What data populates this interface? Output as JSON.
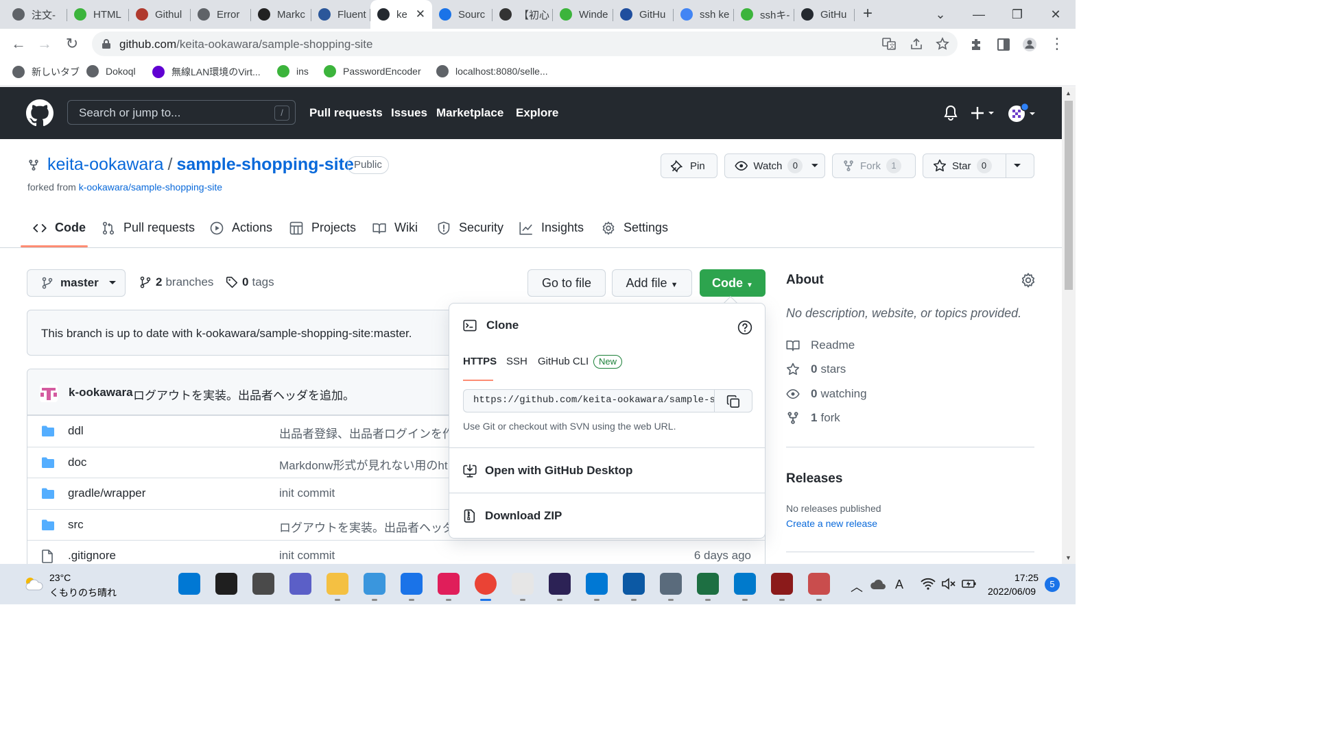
{
  "browser": {
    "tabs": [
      {
        "label": "注文-",
        "color": "#5f6368"
      },
      {
        "label": "HTML",
        "color": "#3cb43c"
      },
      {
        "label": "Githul",
        "color": "#b03a2e"
      },
      {
        "label": "Error",
        "color": "#5f6368"
      },
      {
        "label": "Markc",
        "color": "#222222"
      },
      {
        "label": "Fluent",
        "color": "#2b579a"
      },
      {
        "label": "ke",
        "color": "#24292f",
        "active": true
      },
      {
        "label": "Sourc",
        "color": "#1a73e8"
      },
      {
        "label": "【初心",
        "color": "#333333"
      },
      {
        "label": "Winde",
        "color": "#3cb43c"
      },
      {
        "label": "GitHu",
        "color": "#1f4e9e"
      },
      {
        "label": "ssh ke",
        "color": "#4285f4"
      },
      {
        "label": "sshキ-",
        "color": "#3cb43c"
      },
      {
        "label": "GitHu",
        "color": "#24292f"
      }
    ],
    "url_host": "github.com",
    "url_path": "/keita-ookawara/sample-shopping-site",
    "bookmarks": [
      {
        "label": "新しいタブ",
        "color": "#5f6368"
      },
      {
        "label": "Dokoql",
        "color": "#5f6368"
      },
      {
        "label": "無線LAN環境のVirt...",
        "color": "#6001d2"
      },
      {
        "label": "ins",
        "color": "#3cb43c"
      },
      {
        "label": "PasswordEncoder",
        "color": "#3cb43c"
      },
      {
        "label": "localhost:8080/selle...",
        "color": "#5f6368"
      }
    ]
  },
  "github": {
    "search_placeholder": "Search or jump to...",
    "search_key": "/",
    "nav": [
      "Pull requests",
      "Issues",
      "Marketplace",
      "Explore"
    ]
  },
  "repo": {
    "owner": "keita-ookawara",
    "name": "sample-shopping-site",
    "visibility": "Public",
    "forked_prefix": "forked from",
    "forked_source": "k-ookawara/sample-shopping-site",
    "pin_label": "Pin",
    "watch_label": "Watch",
    "watch_count": "0",
    "fork_label": "Fork",
    "fork_count": "1",
    "star_label": "Star",
    "star_count": "0",
    "tabs": [
      "Code",
      "Pull requests",
      "Actions",
      "Projects",
      "Wiki",
      "Security",
      "Insights",
      "Settings"
    ],
    "branch": "master",
    "branches_count": "2",
    "branches_label": "branches",
    "tags_count": "0",
    "tags_label": "tags",
    "go_to_file": "Go to file",
    "add_file": "Add file",
    "code_btn": "Code",
    "up_to_date": "This branch is up to date with k-ookawara/sample-shopping-site:master.",
    "commit_author": "k-ookawara",
    "commit_message": "ログアウトを実装。出品者ヘッダを追加。",
    "files": [
      {
        "name": "ddl",
        "type": "dir",
        "message": "出品者登録、出品者ログインを作",
        "age": ""
      },
      {
        "name": "doc",
        "type": "dir",
        "message": "Markdonw形式が見れない用のht",
        "age": ""
      },
      {
        "name": "gradle/wrapper",
        "type": "dir",
        "message": "init commit",
        "age": ""
      },
      {
        "name": "src",
        "type": "dir",
        "message": "ログアウトを実装。出品者ヘッダ",
        "age": ""
      },
      {
        "name": ".gitignore",
        "type": "file",
        "message": "init commit",
        "age": "6 days ago"
      }
    ]
  },
  "clone": {
    "title": "Clone",
    "tabs": [
      "HTTPS",
      "SSH",
      "GitHub CLI"
    ],
    "new_badge": "New",
    "url": "https://github.com/keita-ookawara/sample-shopping-site.git",
    "hint": "Use Git or checkout with SVN using the web URL.",
    "open_desktop": "Open with GitHub Desktop",
    "download_zip": "Download ZIP"
  },
  "about": {
    "heading": "About",
    "description": "No description, website, or topics provided.",
    "readme": "Readme",
    "stars_count": "0",
    "stars_label": "stars",
    "watching_count": "0",
    "watching_label": "watching",
    "forks_count": "1",
    "forks_label": "fork",
    "releases_heading": "Releases",
    "releases_none": "No releases published",
    "releases_create": "Create a new release"
  },
  "taskbar": {
    "temperature": "23°C",
    "weather": "くもりのち晴れ",
    "time": "17:25",
    "date": "2022/06/09",
    "notifications": "5",
    "ime": "A",
    "apps": [
      {
        "name": "windows-start-icon",
        "color": "#0078d4"
      },
      {
        "name": "search-icon",
        "color": "#1f1f1f"
      },
      {
        "name": "task-view-icon",
        "color": "#4a4a4a"
      },
      {
        "name": "teams-chat-icon",
        "color": "#5b5fc7"
      },
      {
        "name": "file-explorer-icon",
        "color": "#f4c042"
      },
      {
        "name": "microsoft-store-icon",
        "color": "#3a96dd"
      },
      {
        "name": "mail-icon",
        "color": "#1a73e8"
      },
      {
        "name": "slack-icon",
        "color": "#e01e5a"
      },
      {
        "name": "chrome-icon",
        "color": "#ea4335"
      },
      {
        "name": "notepad-icon",
        "color": "#e6e6e6"
      },
      {
        "name": "eclipse-icon",
        "color": "#2c2255"
      },
      {
        "name": "maps-icon",
        "color": "#0078d4"
      },
      {
        "name": "edge-icon",
        "color": "#0c59a4"
      },
      {
        "name": "settings-icon",
        "color": "#5a6b7c"
      },
      {
        "name": "excel-icon",
        "color": "#1d6f42"
      },
      {
        "name": "vscode-icon",
        "color": "#007acc"
      },
      {
        "name": "tomcat-icon",
        "color": "#8b1a1a"
      },
      {
        "name": "snipping-tool-icon",
        "color": "#c94d4d"
      }
    ]
  }
}
